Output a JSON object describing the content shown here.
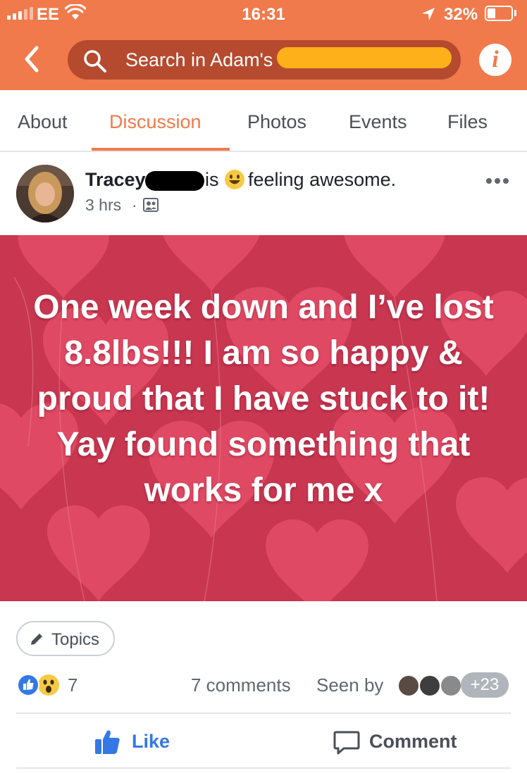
{
  "status_bar": {
    "carrier": "EE",
    "time": "16:31",
    "battery": "32%",
    "battery_level": 0.32,
    "icons": [
      "signal-icon",
      "wifi-icon",
      "location-arrow-icon",
      "battery-icon"
    ]
  },
  "header": {
    "search_text": "Search in Adam's",
    "icons": [
      "back-chevron-icon",
      "search-icon",
      "info-icon"
    ],
    "info_label": "i",
    "accent_color": "#f07a4b"
  },
  "tabs": [
    {
      "label": "About",
      "active": false
    },
    {
      "label": "Discussion",
      "active": true
    },
    {
      "label": "Photos",
      "active": false
    },
    {
      "label": "Events",
      "active": false
    },
    {
      "label": "Files",
      "active": false
    }
  ],
  "post": {
    "author": "Tracey",
    "is_text": "is",
    "feeling": "feeling awesome.",
    "time": "3 hrs",
    "separator": "·",
    "image_text": "One week down and I’ve lost 8.8lbs!!! I am so happy & proud that I have stuck to it! Yay found something that works for me x",
    "image_background": "#c83650"
  },
  "footer": {
    "topics_label": "Topics",
    "reactions_count": "7",
    "reaction_icons": [
      "like-reaction-icon",
      "wow-reaction-icon"
    ],
    "comments": "7 comments",
    "seen_by": "Seen by",
    "seen_more": "+23",
    "like_label": "Like",
    "comment_label": "Comment",
    "like_color": "#3578e5"
  }
}
